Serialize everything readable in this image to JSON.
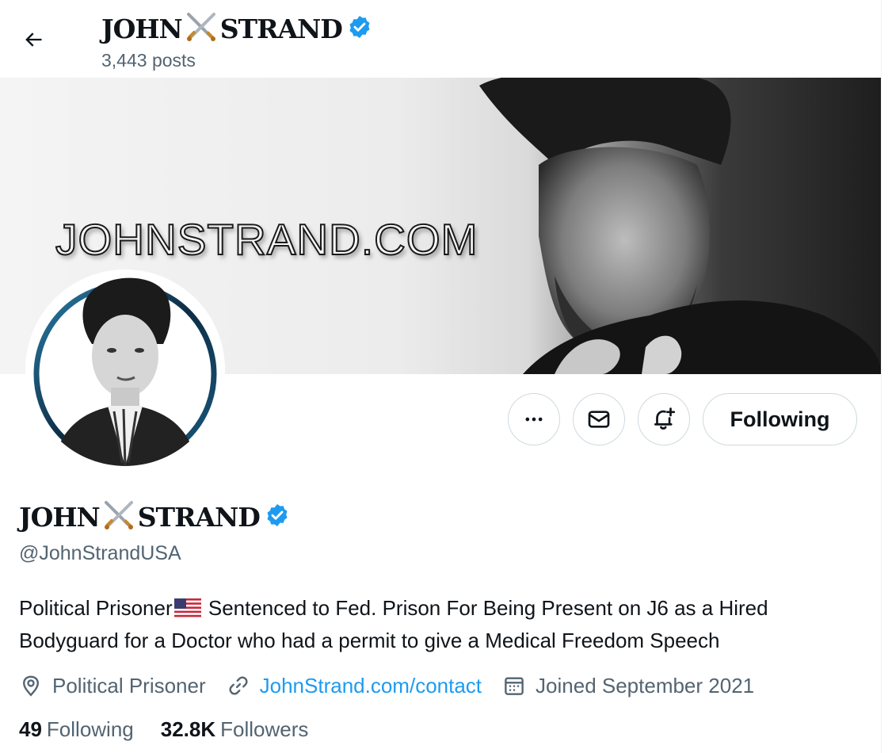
{
  "header": {
    "name_left": "JOHN",
    "name_right": "STRAND",
    "posts": "3,443 posts"
  },
  "banner": {
    "text": "JOHNSTRAND.COM"
  },
  "actions": {
    "following_label": "Following"
  },
  "profile": {
    "name_left": "JOHN",
    "name_right": "STRAND",
    "handle": "@JohnStrandUSA",
    "bio_part1": "Political Prisoner",
    "bio_part2": " Sentenced to Fed. Prison For Being Present on J6 as a Hired Bodyguard for a Doctor who had a permit to give a Medical Freedom Speech",
    "location": "Political Prisoner",
    "website": "JohnStrand.com/contact",
    "joined": "Joined September 2021"
  },
  "stats": {
    "following_count": "49",
    "following_label": "Following",
    "followers_count": "32.8K",
    "followers_label": "Followers"
  },
  "colors": {
    "accent": "#1d9bf0",
    "secondary_text": "#536471",
    "primary_text": "#0f1419",
    "border": "#cfd9de"
  },
  "icons": [
    "back-arrow-icon",
    "crossed-swords-icon",
    "verified-badge-icon",
    "more-icon",
    "message-icon",
    "notification-bell-icon",
    "location-pin-icon",
    "link-icon",
    "calendar-icon",
    "us-flag-icon"
  ]
}
